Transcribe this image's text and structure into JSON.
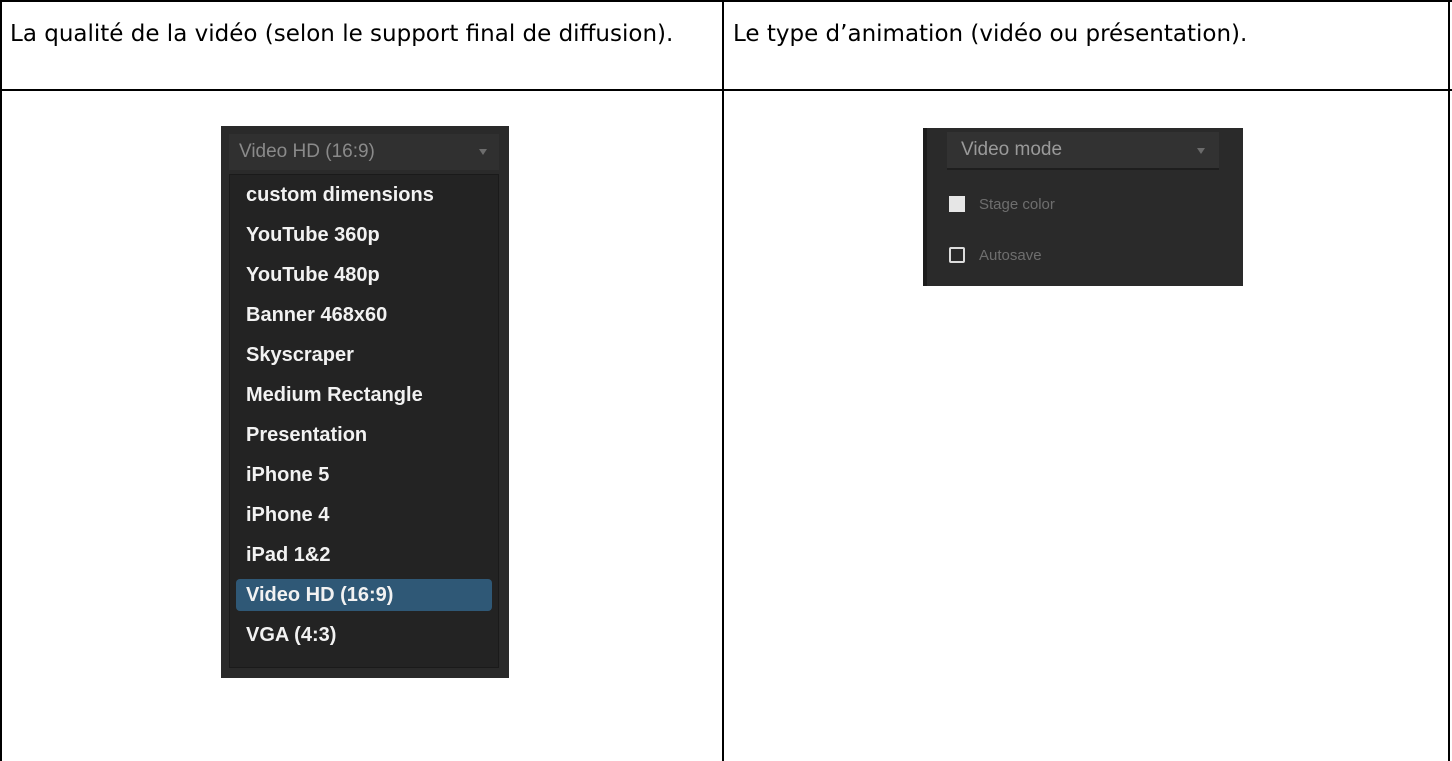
{
  "table": {
    "header_left": "La qualité de la vidéo (selon le support final de diffusion).",
    "header_right": "Le type d’animation (vidéo ou présentation)."
  },
  "quality_dropdown": {
    "selected_value": "Video HD (16:9)",
    "arrow_icon": "chevron-down-icon",
    "options": [
      "custom dimensions",
      "YouTube 360p",
      "YouTube 480p",
      "Banner 468x60",
      "Skyscraper",
      "Medium Rectangle",
      "Presentation",
      "iPhone 5",
      "iPhone 4",
      "iPad 1&2",
      "Video HD (16:9)",
      "VGA (4:3)"
    ],
    "highlighted_option": "Video HD (16:9)"
  },
  "mode_panel": {
    "mode_value": "Video mode",
    "stage_color_label": "Stage color",
    "autosave_label": "Autosave",
    "autosave_checked": false
  },
  "colors": {
    "panel_background": "#2a2a2a",
    "selection_highlight": "#2f5876",
    "stage_swatch": "#e6e6e6"
  }
}
